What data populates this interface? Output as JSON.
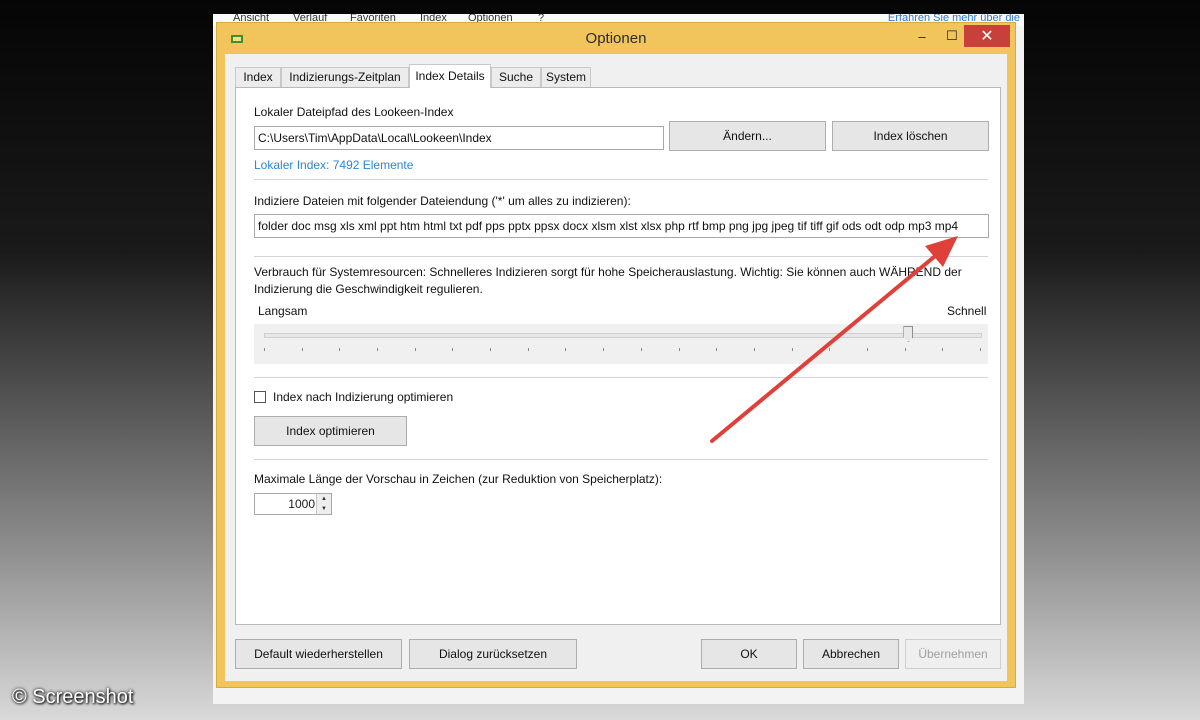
{
  "background_app": {
    "menu": [
      "Ansicht",
      "Verlauf",
      "Favoriten",
      "Index",
      "Optionen",
      "?"
    ],
    "link": "Erfahren Sie mehr über die"
  },
  "dialog": {
    "title": "Optionen",
    "window_buttons": {
      "minimize": "–",
      "maximize": "☐",
      "close": "✕"
    },
    "tabs": [
      "Index",
      "Indizierungs-Zeitplan",
      "Index Details",
      "Suche",
      "System"
    ],
    "active_tab": "Index Details"
  },
  "index_path": {
    "label": "Lokaler Dateipfad des Lookeen-Index",
    "value": "C:\\Users\\Tim\\AppData\\Local\\Lookeen\\Index",
    "change_button": "Ändern...",
    "delete_button": "Index löschen",
    "info_link": "Lokaler Index: 7492 Elemente"
  },
  "extensions": {
    "label": "Indiziere Dateien mit folgender Dateiendung ('*' um alles zu indizieren):",
    "value": "folder doc msg xls xml ppt htm html txt pdf pps pptx ppsx docx xlsm xlst xlsx php rtf bmp png jpg jpeg tif tiff gif ods odt odp mp3 mp4"
  },
  "resources": {
    "description_line1": "Verbrauch für Systemresourcen: Schnelleres Indizieren sorgt für hohe Speicherauslastung. Wichtig: Sie können auch WÄHREND der",
    "description_line2": "Indizierung die Geschwindigkeit regulieren.",
    "slow_label": "Langsam",
    "fast_label": "Schnell",
    "slider_level": 0.9,
    "tick_count": 20
  },
  "optimize": {
    "checkbox_label": "Index nach Indizierung optimieren",
    "checked": false,
    "button": "Index optimieren"
  },
  "preview": {
    "label": "Maximale Länge der Vorschau in Zeichen (zur Reduktion von Speicherplatz):",
    "value": "1000"
  },
  "footer": {
    "default_button": "Default wiederherstellen",
    "reset_button": "Dialog zurücksetzen",
    "ok_button": "OK",
    "cancel_button": "Abbrechen",
    "apply_button": "Übernehmen"
  },
  "colors": {
    "dialog_frame": "#f2c55c",
    "close_button": "#c7403a",
    "link": "#2a86d8",
    "annotation_arrow": "#e0403a"
  },
  "watermark": "© Screenshot"
}
